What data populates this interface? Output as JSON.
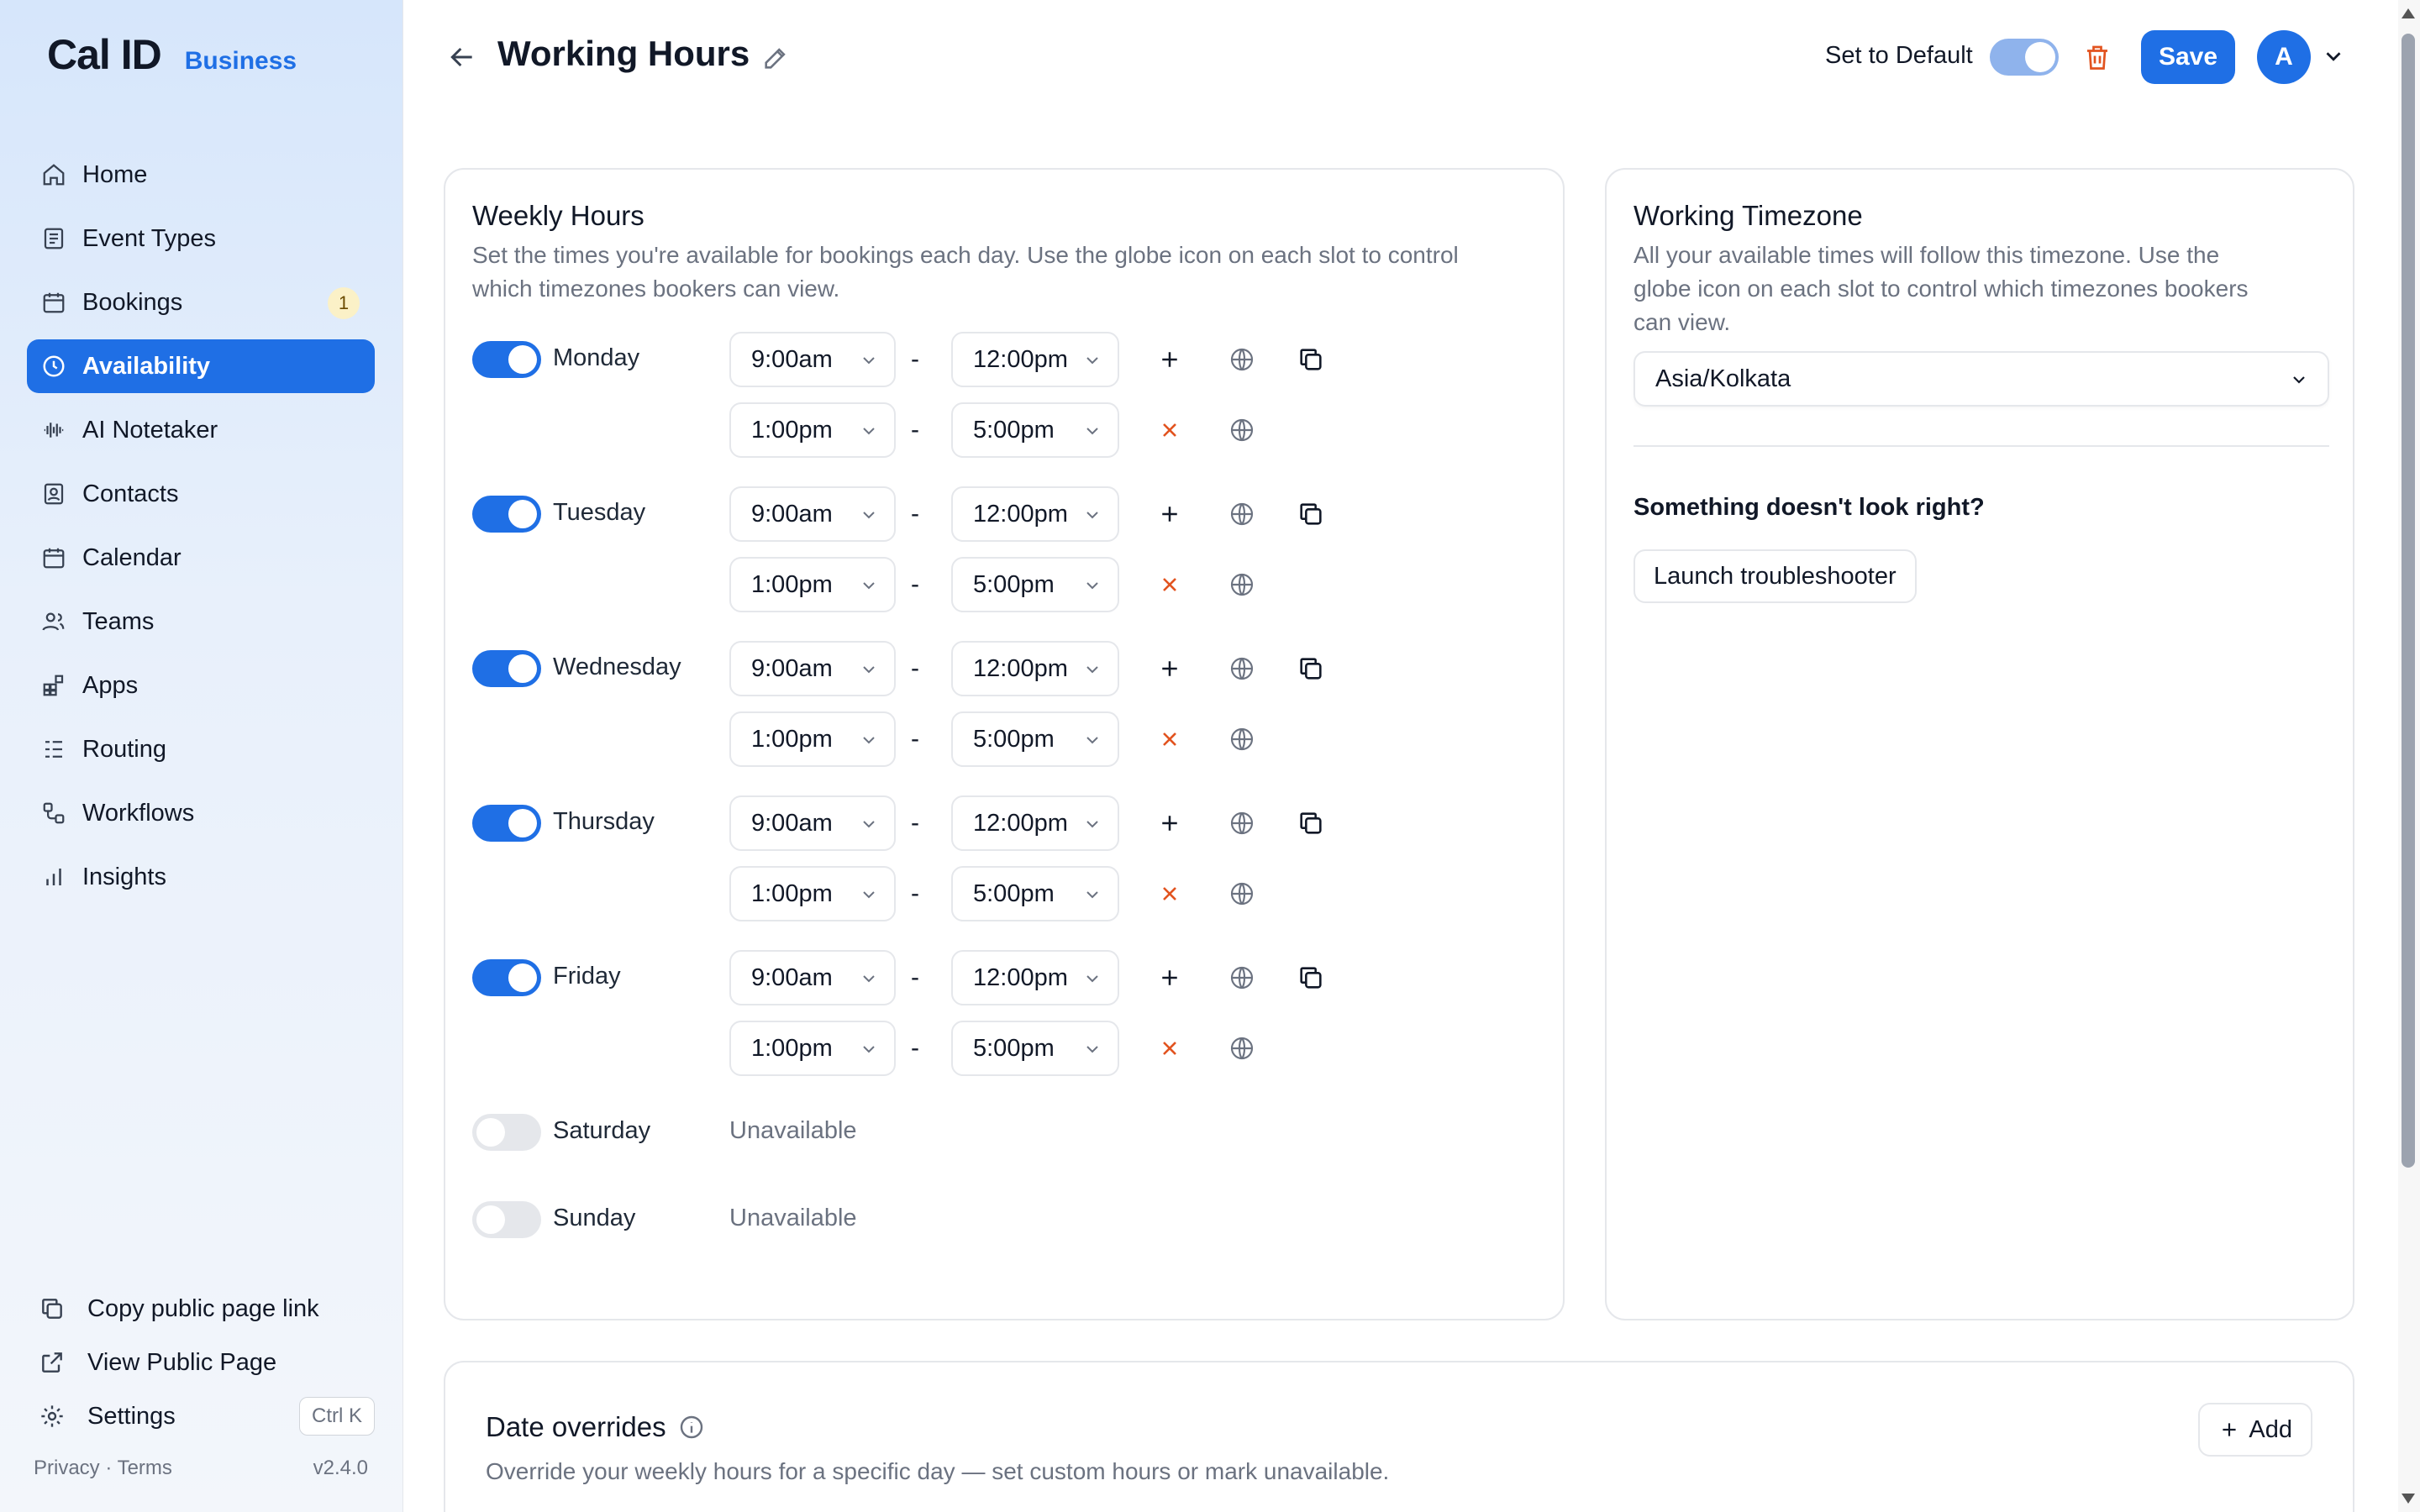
{
  "app": {
    "brand": "Cal ID",
    "tier": "Business"
  },
  "sidebar": {
    "items": [
      {
        "label": "Home",
        "icon": "home-icon"
      },
      {
        "label": "Event Types",
        "icon": "event-types-icon"
      },
      {
        "label": "Bookings",
        "icon": "calendar-icon",
        "badge": "1"
      },
      {
        "label": "Availability",
        "icon": "clock-icon",
        "active": true
      },
      {
        "label": "AI Notetaker",
        "icon": "waveform-icon"
      },
      {
        "label": "Contacts",
        "icon": "contact-icon"
      },
      {
        "label": "Calendar",
        "icon": "calendar-icon"
      },
      {
        "label": "Teams",
        "icon": "users-icon"
      },
      {
        "label": "Apps",
        "icon": "apps-icon"
      },
      {
        "label": "Routing",
        "icon": "routing-icon"
      },
      {
        "label": "Workflows",
        "icon": "workflow-icon"
      },
      {
        "label": "Insights",
        "icon": "bar-chart-icon"
      }
    ],
    "bottom": {
      "copy_link": "Copy public page link",
      "view_public": "View Public Page",
      "settings": "Settings",
      "shortcut": "Ctrl K"
    },
    "footer": {
      "links": "Privacy · Terms",
      "version": "v2.4.0"
    }
  },
  "header": {
    "title": "Working Hours",
    "set_default_label": "Set to Default",
    "save_label": "Save",
    "avatar_initial": "A"
  },
  "weekly": {
    "title": "Weekly Hours",
    "description_line1": "Set the times you're available for bookings each day. Use the globe icon on each slot to control",
    "description_line2": "which timezones bookers can view.",
    "separator": "-",
    "unavailable_label": "Unavailable",
    "days": [
      {
        "name": "Monday",
        "enabled": true,
        "slots": [
          {
            "start": "9:00am",
            "end": "12:00pm"
          },
          {
            "start": "1:00pm",
            "end": "5:00pm"
          }
        ]
      },
      {
        "name": "Tuesday",
        "enabled": true,
        "slots": [
          {
            "start": "9:00am",
            "end": "12:00pm"
          },
          {
            "start": "1:00pm",
            "end": "5:00pm"
          }
        ]
      },
      {
        "name": "Wednesday",
        "enabled": true,
        "slots": [
          {
            "start": "9:00am",
            "end": "12:00pm"
          },
          {
            "start": "1:00pm",
            "end": "5:00pm"
          }
        ]
      },
      {
        "name": "Thursday",
        "enabled": true,
        "slots": [
          {
            "start": "9:00am",
            "end": "12:00pm"
          },
          {
            "start": "1:00pm",
            "end": "5:00pm"
          }
        ]
      },
      {
        "name": "Friday",
        "enabled": true,
        "slots": [
          {
            "start": "9:00am",
            "end": "12:00pm"
          },
          {
            "start": "1:00pm",
            "end": "5:00pm"
          }
        ]
      },
      {
        "name": "Saturday",
        "enabled": false,
        "slots": []
      },
      {
        "name": "Sunday",
        "enabled": false,
        "slots": []
      }
    ]
  },
  "timezone": {
    "title": "Working Timezone",
    "description_line1": "All your available times will follow this timezone. Use the",
    "description_line2": "globe icon on each slot to control which timezones bookers",
    "description_line3": "can view.",
    "selected": "Asia/Kolkata",
    "troubleshoot_question": "Something doesn't look right?",
    "troubleshoot_button": "Launch troubleshooter"
  },
  "overrides": {
    "title": "Date overrides",
    "description": "Override your weekly hours for a specific day — set custom hours or mark unavailable.",
    "add_label": "Add"
  },
  "colors": {
    "accent": "#1f6fe5",
    "danger": "#e2531f",
    "muted": "#6b7280",
    "border": "#e5e7eb"
  }
}
